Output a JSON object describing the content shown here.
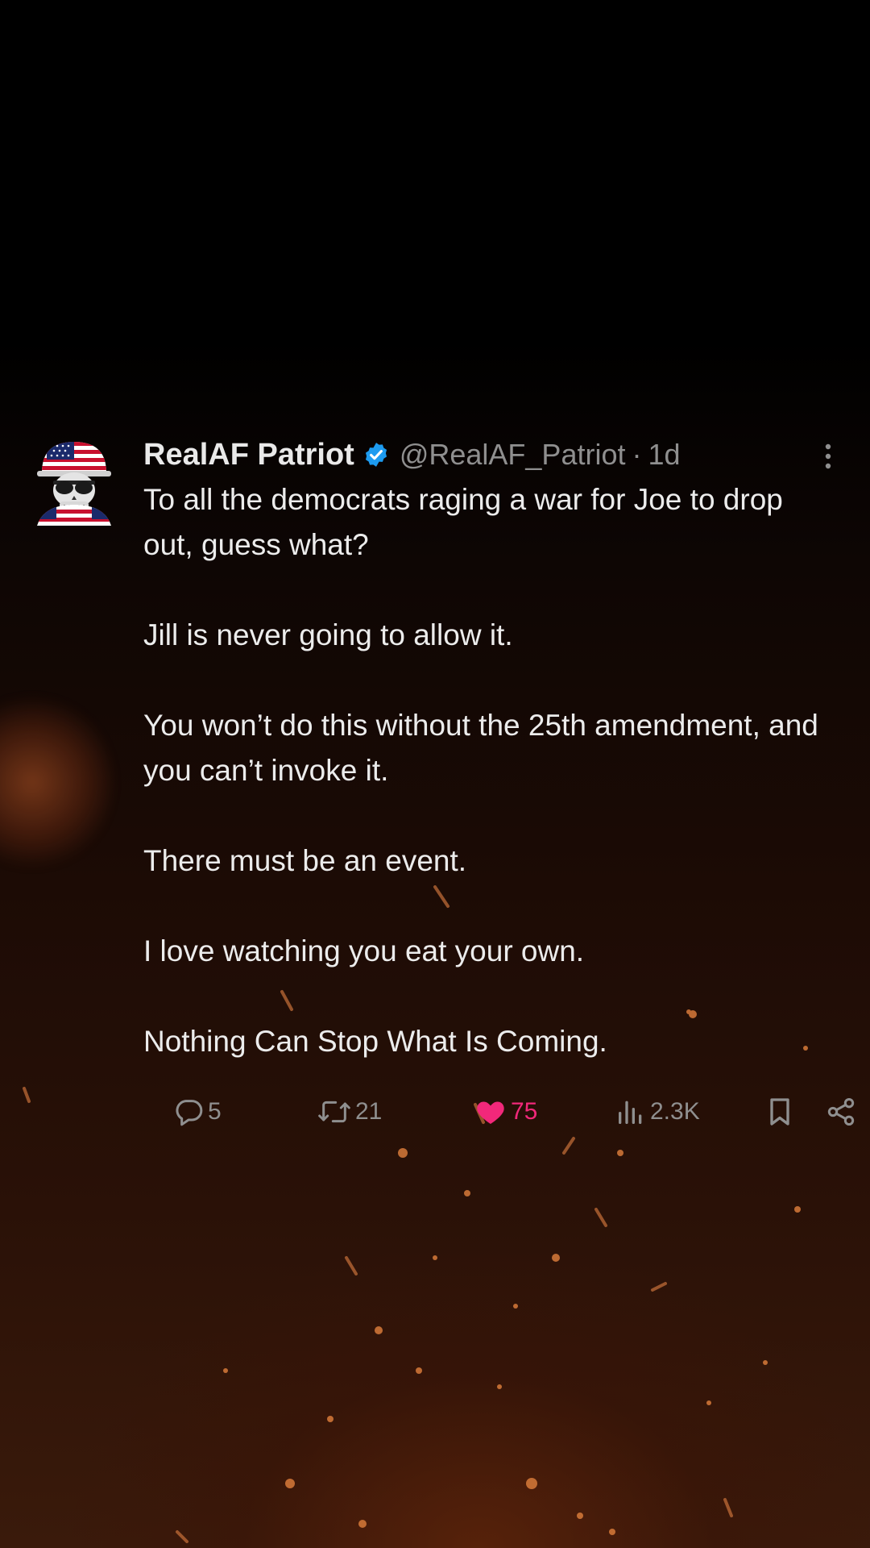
{
  "post": {
    "display_name": "RealAF Patriot",
    "handle": "@RealAF_Patriot",
    "separator": "·",
    "timestamp": "1d",
    "verified": true,
    "avatar_icon": "skull-with-american-flag-hat-icon",
    "paragraphs": [
      "To all the democrats raging a war for Joe to drop out, guess what?",
      "Jill is never going to allow it.",
      "You won’t do this without the 25th amendment, and you can’t invoke it.",
      "There must be an event.",
      "I love watching you eat your own.",
      "Nothing Can Stop What Is Coming."
    ]
  },
  "actions": {
    "replies": "5",
    "reposts": "21",
    "likes": "75",
    "views": "2.3K",
    "liked": true,
    "icons": [
      "reply-icon",
      "repost-icon",
      "like-icon",
      "views-icon",
      "bookmark-icon",
      "share-icon"
    ]
  },
  "colors": {
    "background": "#000000",
    "ember_glow": "#3a1a0b",
    "text_primary": "#ececec",
    "text_secondary": "#8f8f8f",
    "verified_blue": "#1d9bf0",
    "like_pink": "#f2287a"
  }
}
